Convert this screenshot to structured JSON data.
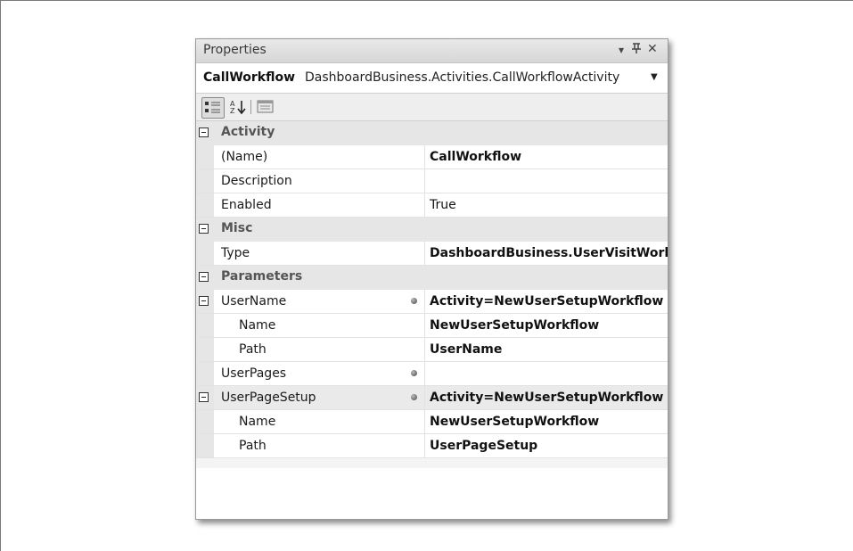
{
  "panel": {
    "title": "Properties",
    "icons": {
      "dropdown": "▾",
      "pin": "ᵾ",
      "close": "✕"
    }
  },
  "selector": {
    "name": "CallWorkflow",
    "type": "DashboardBusiness.Activities.CallWorkflowActivity",
    "arrow": "▼"
  },
  "toolbar": {
    "items": [
      "categorized-view-icon",
      "alphabetical-sort-icon",
      "property-pages-icon"
    ],
    "sort_glyph": "A\nZ↓"
  },
  "grid": {
    "rows": [
      {
        "kind": "category",
        "label": "Activity"
      },
      {
        "kind": "prop",
        "name": "(Name)",
        "value": "CallWorkflow",
        "bold": true
      },
      {
        "kind": "prop",
        "name": "Description",
        "value": ""
      },
      {
        "kind": "prop",
        "name": "Enabled",
        "value": "True"
      },
      {
        "kind": "category",
        "label": "Misc"
      },
      {
        "kind": "prop",
        "name": "Type",
        "value": "DashboardBusiness.UserVisitWork",
        "bold": true
      },
      {
        "kind": "category",
        "label": "Parameters"
      },
      {
        "kind": "prop",
        "name": "UserName",
        "value": "Activity=NewUserSetupWorkflow",
        "bold": true,
        "expander": true,
        "bind": true
      },
      {
        "kind": "prop",
        "name": "Name",
        "value": "NewUserSetupWorkflow",
        "bold": true,
        "indent": true
      },
      {
        "kind": "prop",
        "name": "Path",
        "value": "UserName",
        "bold": true,
        "indent": true
      },
      {
        "kind": "prop",
        "name": "UserPages",
        "value": "",
        "bind": true
      },
      {
        "kind": "prop",
        "name": "UserPageSetup",
        "value": "Activity=NewUserSetupWorkflow",
        "bold": true,
        "expander": true,
        "bind": true,
        "shade": true
      },
      {
        "kind": "prop",
        "name": "Name",
        "value": "NewUserSetupWorkflow",
        "bold": true,
        "indent": true
      },
      {
        "kind": "prop",
        "name": "Path",
        "value": "UserPageSetup",
        "bold": true,
        "indent": true
      }
    ]
  }
}
